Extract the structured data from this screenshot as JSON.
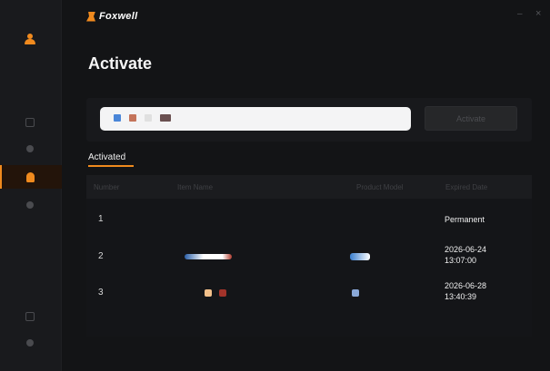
{
  "header": {
    "brand": "Foxwell",
    "version_text": "",
    "minimize": "–",
    "close": "×"
  },
  "page": {
    "title": "Activate"
  },
  "activation": {
    "input_value": "",
    "input_placeholder": "",
    "button_label": "Activate"
  },
  "tabs": {
    "activated": "Activated"
  },
  "table": {
    "columns": [
      "Number",
      "Item Name",
      "Product Model",
      "Expired Date"
    ],
    "rows": [
      {
        "number": "1",
        "expired": "Permanent"
      },
      {
        "number": "2",
        "expired_line1": "2026-06-24",
        "expired_line2": "13:07:00"
      },
      {
        "number": "3",
        "expired_line1": "2026-06-28",
        "expired_line2": "13:40:39"
      }
    ]
  },
  "icons": {
    "brand": "logo-icon",
    "profile": "user-icon",
    "nav": [
      "list-icon",
      "device-icon",
      "activate-icon",
      "settings-icon",
      "help-icon",
      "info-icon"
    ]
  },
  "colors": {
    "accent": "#f08a1e",
    "background": "#131416",
    "sidebar": "#191a1d",
    "input": "#f4f4f5"
  }
}
